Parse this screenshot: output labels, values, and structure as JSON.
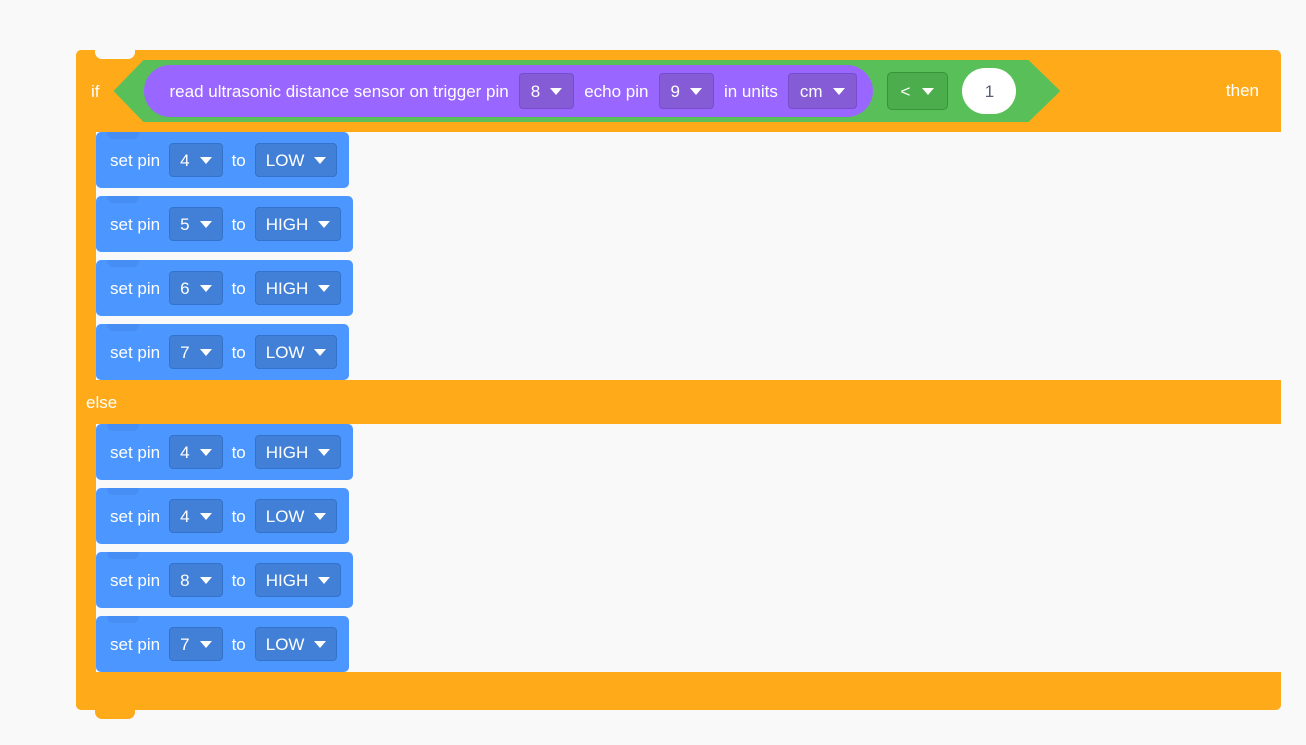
{
  "canvas": {
    "background_color": "#f9f9f9"
  },
  "colors": {
    "control_orange": "#ffab19",
    "operator_green": "#59c059",
    "sensing_purple": "#9966ff",
    "pin_blue": "#4c97ff",
    "field_white": "#ffffff",
    "number_text": "#575e75"
  },
  "script": {
    "if_block": {
      "if_label": "if",
      "then_label": "then",
      "else_label": "else",
      "condition": {
        "operator": {
          "symbol": "<",
          "has_dropdown": true,
          "caret_icon": "chevron-down-icon"
        },
        "right_operand": "1",
        "sensor_reporter": {
          "text_1": "read ultrasonic distance sensor on trigger pin",
          "trigger_pin": "8",
          "text_2": "echo pin",
          "echo_pin": "9",
          "text_3": "in units",
          "units": "cm"
        }
      },
      "then_branch": {
        "blocks": [
          {
            "prefix": "set pin",
            "pin": "4",
            "middle": "to",
            "state": "LOW"
          },
          {
            "prefix": "set pin",
            "pin": "5",
            "middle": "to",
            "state": "HIGH"
          },
          {
            "prefix": "set pin",
            "pin": "6",
            "middle": "to",
            "state": "HIGH"
          },
          {
            "prefix": "set pin",
            "pin": "7",
            "middle": "to",
            "state": "LOW"
          }
        ]
      },
      "else_branch": {
        "blocks": [
          {
            "prefix": "set pin",
            "pin": "4",
            "middle": "to",
            "state": "HIGH"
          },
          {
            "prefix": "set pin",
            "pin": "4",
            "middle": "to",
            "state": "LOW"
          },
          {
            "prefix": "set pin",
            "pin": "8",
            "middle": "to",
            "state": "HIGH"
          },
          {
            "prefix": "set pin",
            "pin": "7",
            "middle": "to",
            "state": "LOW"
          }
        ]
      }
    }
  }
}
